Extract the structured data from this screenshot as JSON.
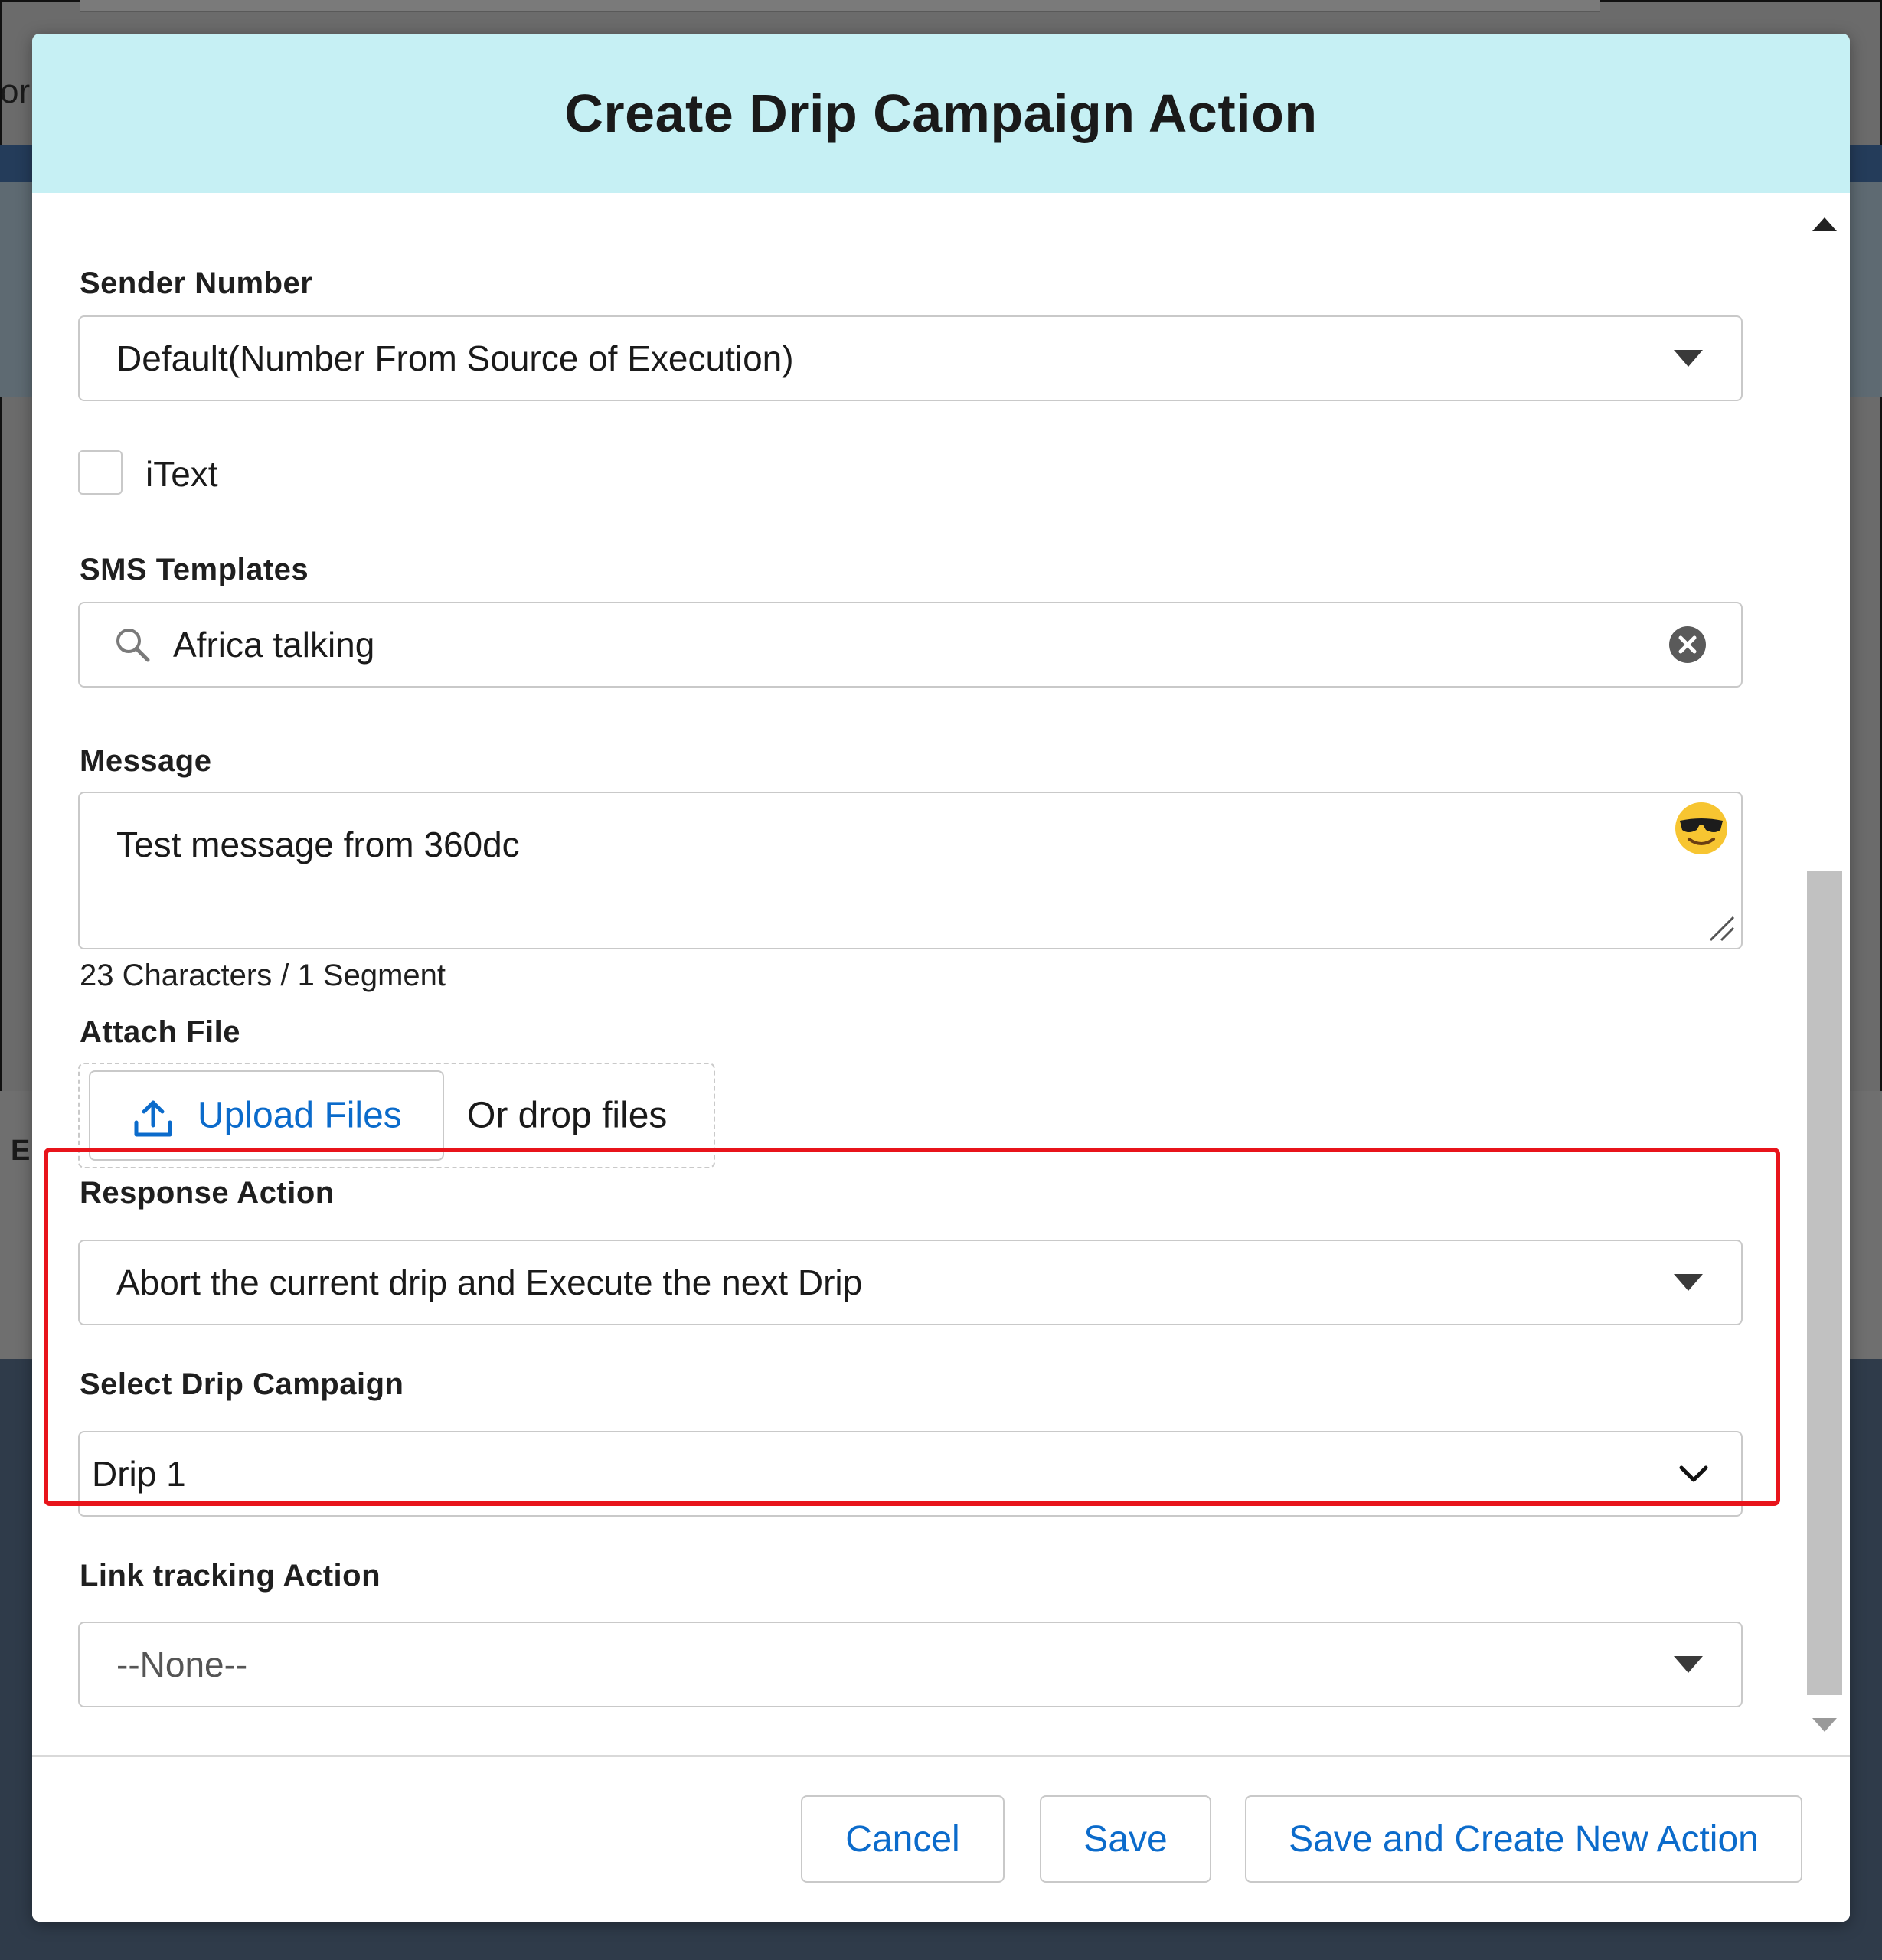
{
  "background": {
    "left_fragment": "or",
    "letter": "E"
  },
  "modal": {
    "title": "Create Drip Campaign Action"
  },
  "sender_number": {
    "label": "Sender Number",
    "value": "Default(Number From Source of Execution)"
  },
  "itext": {
    "label": "iText",
    "checked": false
  },
  "sms_templates": {
    "label": "SMS Templates",
    "value": "Africa talking",
    "icons": [
      "search-icon",
      "clear-icon"
    ]
  },
  "message": {
    "label": "Message",
    "value": "Test message from 360dc",
    "counter": "23 Characters / 1 Segment",
    "icons": [
      "emoji-icon",
      "resize-icon"
    ]
  },
  "attach_file": {
    "label": "Attach File",
    "upload_label": "Upload Files",
    "drop_text": "Or drop files",
    "icon": "upload-icon"
  },
  "response_action": {
    "label": "Response Action",
    "value": "Abort the current drip and Execute the next Drip"
  },
  "select_drip_campaign": {
    "label": "Select Drip Campaign",
    "value": "Drip 1"
  },
  "link_tracking_action": {
    "label": "Link tracking Action",
    "value": "--None--"
  },
  "footer": {
    "cancel_label": "Cancel",
    "save_label": "Save",
    "save_new_label": "Save and Create New Action"
  },
  "colors": {
    "header_bg": "#c6f0f4",
    "link_blue": "#0b6bcb",
    "highlight_red": "#e8141b"
  }
}
